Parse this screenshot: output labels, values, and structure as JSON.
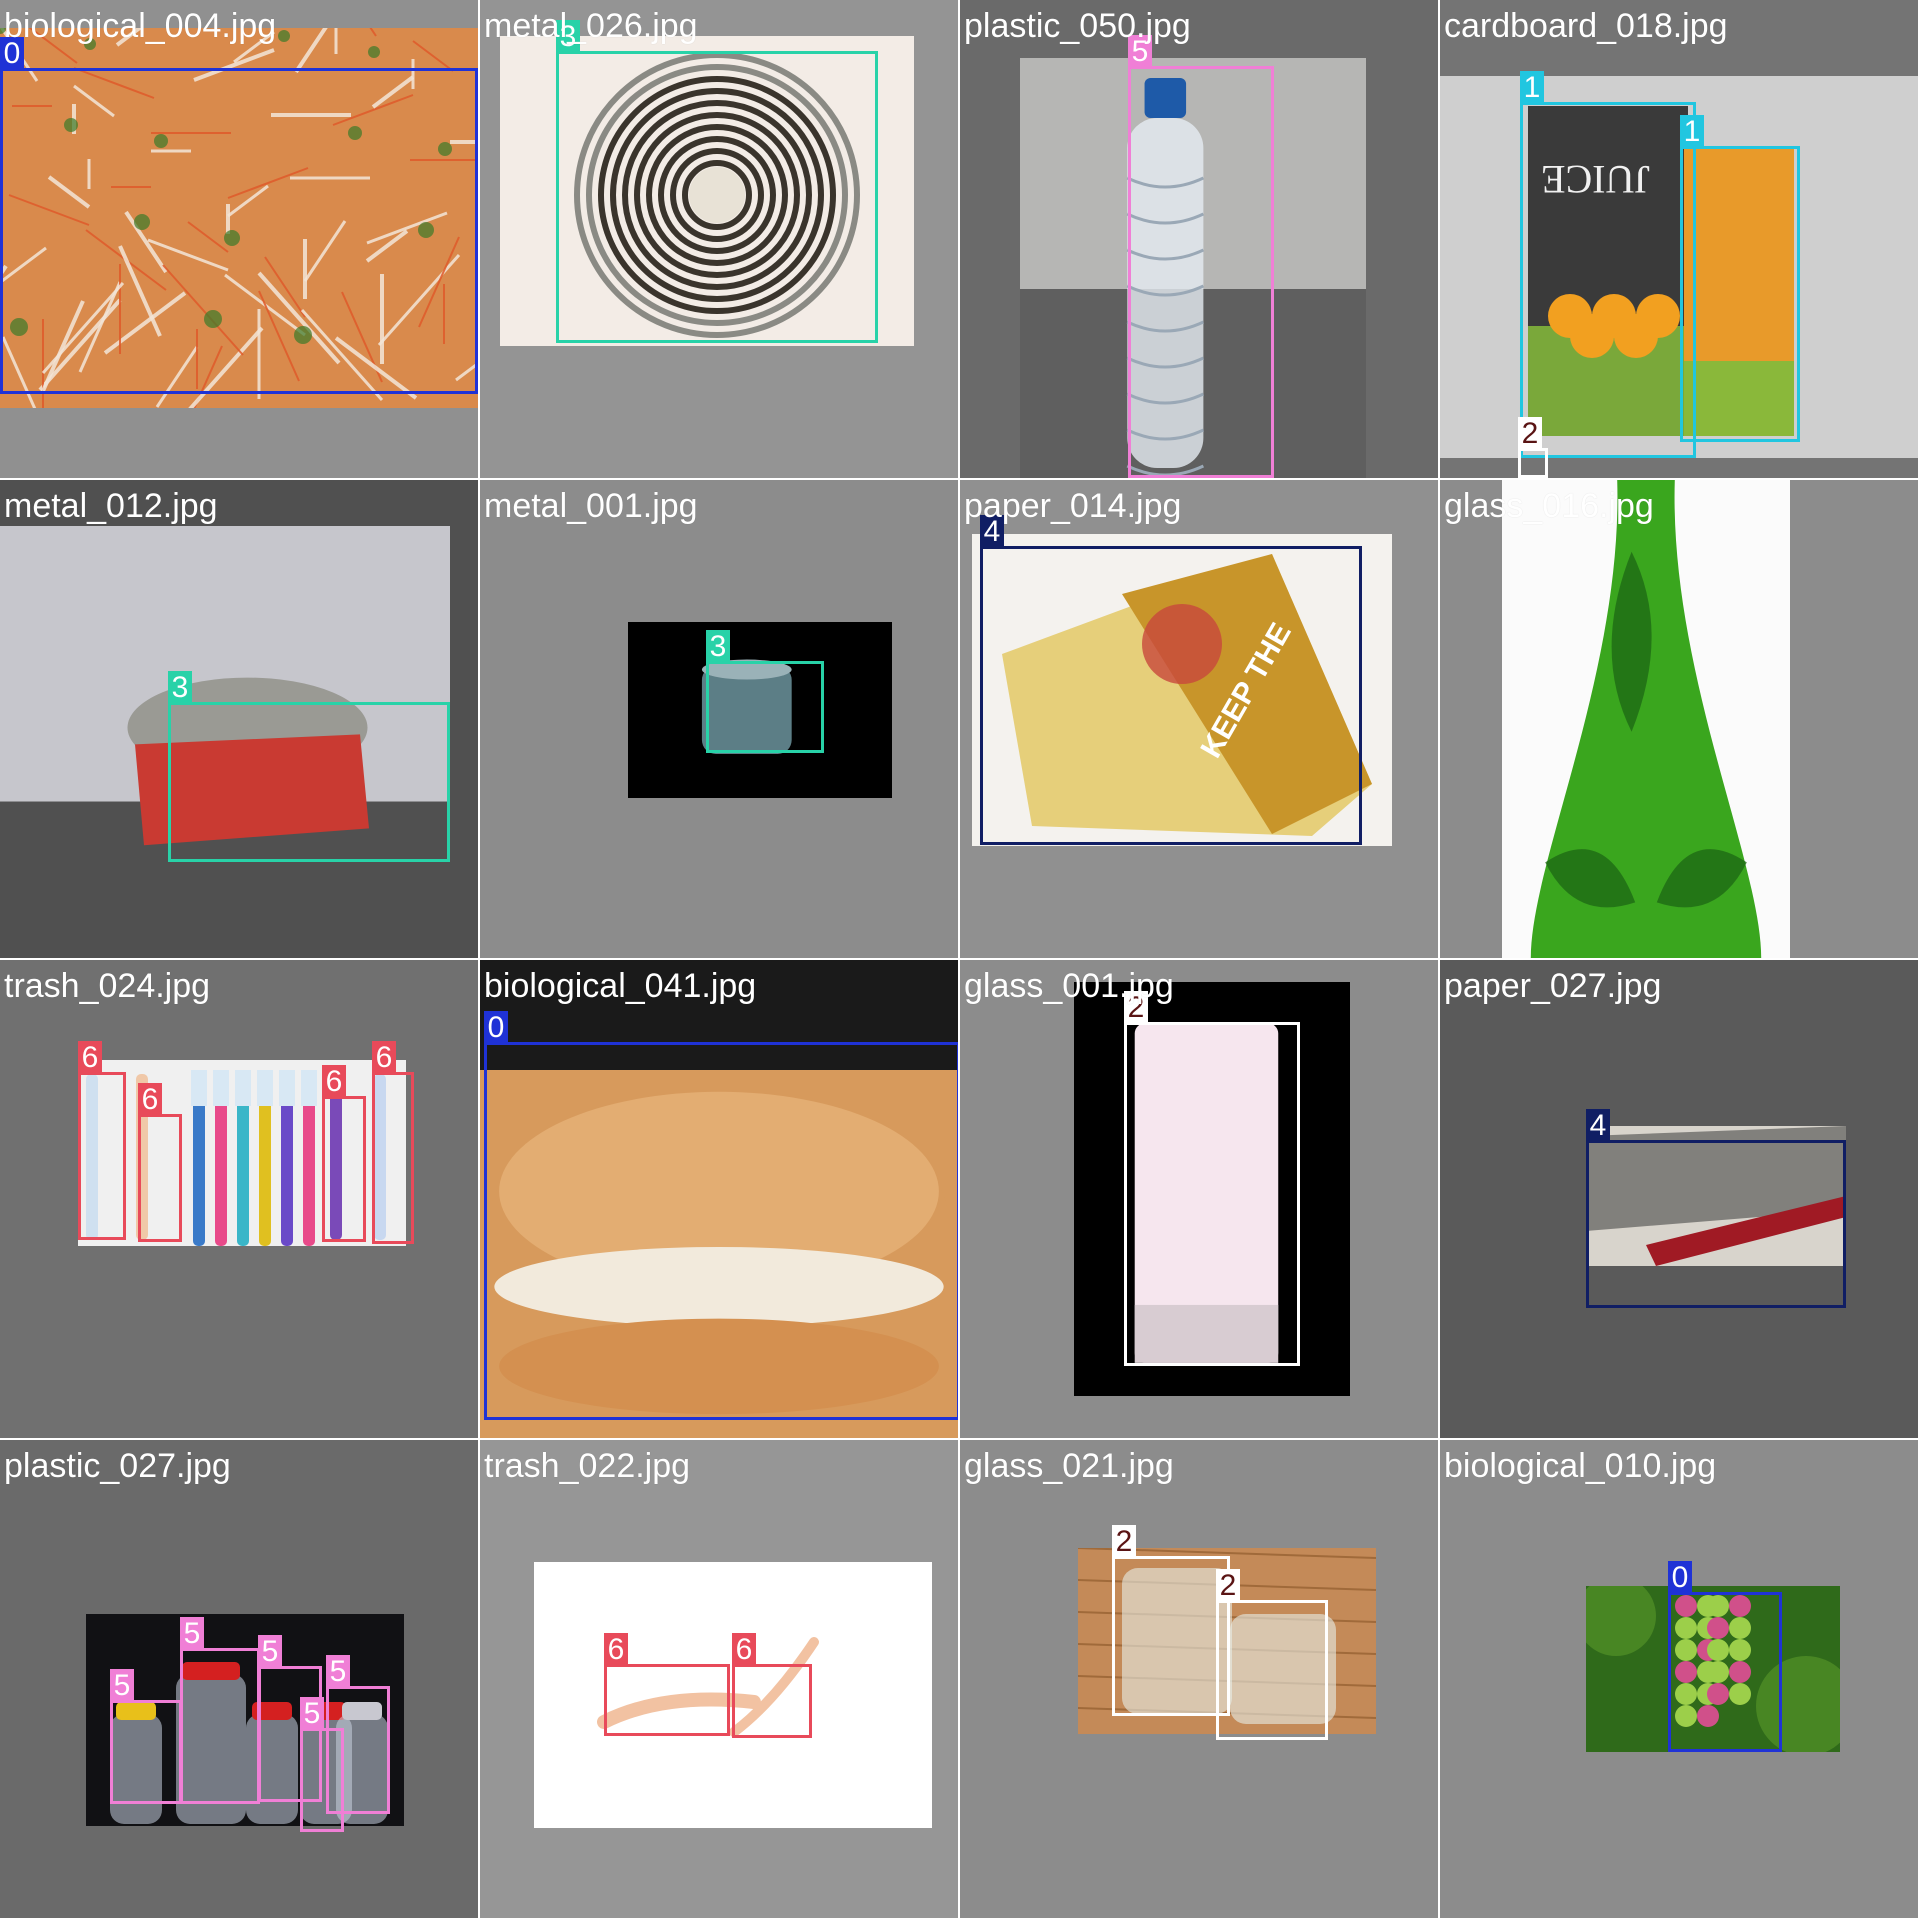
{
  "title": "",
  "class_colors": {
    "0": "#1f32d6",
    "1": "#21c6e0",
    "2": "#ffffff",
    "3": "#28d2a8",
    "4": "#101e64",
    "5": "#f07fd6",
    "6": "#e84a5a"
  },
  "class_label_colors": {
    "2": "#5a1414"
  },
  "tiles": [
    {
      "file": "biological_004.jpg",
      "bg": "#909090",
      "image": {
        "fill": "#d98a4c",
        "accent": "#f3e6d8",
        "texture": "shreds"
      },
      "boxes": [
        {
          "class": "0",
          "label": "0"
        }
      ]
    },
    {
      "file": "metal_026.jpg",
      "bg": "#949494",
      "image": {
        "fill": "#f3ece6",
        "accent": "#2a2620",
        "texture": "can-top"
      },
      "boxes": [
        {
          "class": "3",
          "label": "3"
        }
      ]
    },
    {
      "file": "plastic_050.jpg",
      "bg": "#6a6a6a",
      "image": {
        "fill": "#b6b6b4",
        "accent": "#e6ecf2",
        "texture": "bottle"
      },
      "boxes": [
        {
          "class": "5",
          "label": "5"
        }
      ]
    },
    {
      "file": "cardboard_018.jpg",
      "bg": "#747474",
      "image": {
        "fill": "#cfcfcf",
        "accent": "#3a3a3a",
        "texture": "juice"
      },
      "boxes": [
        {
          "class": "1",
          "label": "1"
        },
        {
          "class": "1",
          "label": "1"
        },
        {
          "class": "2",
          "label": "2"
        }
      ]
    },
    {
      "file": "metal_012.jpg",
      "bg": "#505050",
      "image": {
        "fill": "#c6c6cc",
        "accent": "#c93a32",
        "texture": "red-can"
      },
      "boxes": [
        {
          "class": "3",
          "label": "3"
        }
      ]
    },
    {
      "file": "metal_001.jpg",
      "bg": "#8c8c8c",
      "image": {
        "fill": "#000000",
        "accent": "#5c7e86",
        "texture": "tuna"
      },
      "boxes": [
        {
          "class": "3",
          "label": "3"
        }
      ]
    },
    {
      "file": "paper_014.jpg",
      "bg": "#909090",
      "image": {
        "fill": "#f4f2ee",
        "accent": "#c8952a",
        "texture": "magazine"
      },
      "boxes": [
        {
          "class": "4",
          "label": "4"
        }
      ]
    },
    {
      "file": "glass_016.jpg",
      "bg": "#8c8c8c",
      "image": {
        "fill": "#fbfbfb",
        "accent": "#3aa61e",
        "texture": "vase"
      },
      "boxes": []
    },
    {
      "file": "trash_024.jpg",
      "bg": "#707070",
      "image": {
        "fill": "#f0f0f0",
        "accent": "#3a7ac8",
        "texture": "toothbrush"
      },
      "boxes": [
        {
          "class": "6",
          "label": "6"
        },
        {
          "class": "6",
          "label": "6"
        },
        {
          "class": "6",
          "label": "6"
        },
        {
          "class": "6",
          "label": "6"
        }
      ]
    },
    {
      "file": "biological_041.jpg",
      "bg": "#1a1a1a",
      "image": {
        "fill": "#d79a5c",
        "accent": "#f2eadc",
        "texture": "bun"
      },
      "boxes": [
        {
          "class": "0",
          "label": "0"
        }
      ]
    },
    {
      "file": "glass_001.jpg",
      "bg": "#8c8c8c",
      "image": {
        "fill": "#000000",
        "accent": "#f6e6ee",
        "texture": "glass"
      },
      "boxes": [
        {
          "class": "2",
          "label": "2"
        }
      ]
    },
    {
      "file": "paper_027.jpg",
      "bg": "#5a5a5a",
      "image": {
        "fill": "#d8d4cc",
        "accent": "#a01a24",
        "texture": "book"
      },
      "boxes": [
        {
          "class": "4",
          "label": "4"
        }
      ]
    },
    {
      "file": "plastic_027.jpg",
      "bg": "#6a6a6a",
      "image": {
        "fill": "#111114",
        "accent": "#d42020",
        "texture": "jars"
      },
      "boxes": [
        {
          "class": "5",
          "label": "5"
        },
        {
          "class": "5",
          "label": "5"
        },
        {
          "class": "5",
          "label": "5"
        },
        {
          "class": "5",
          "label": "5"
        },
        {
          "class": "5",
          "label": "5"
        }
      ]
    },
    {
      "file": "trash_022.jpg",
      "bg": "#969696",
      "image": {
        "fill": "#ffffff",
        "accent": "#f2c2a2",
        "texture": "smear"
      },
      "boxes": [
        {
          "class": "6",
          "label": "6"
        },
        {
          "class": "6",
          "label": "6"
        }
      ]
    },
    {
      "file": "glass_021.jpg",
      "bg": "#8c8c8c",
      "image": {
        "fill": "#c48a58",
        "accent": "#e8efe8",
        "texture": "jar-glass"
      },
      "boxes": [
        {
          "class": "2",
          "label": "2"
        },
        {
          "class": "2",
          "label": "2"
        }
      ]
    },
    {
      "file": "biological_010.jpg",
      "bg": "#8c8c8c",
      "image": {
        "fill": "#2f6a1a",
        "accent": "#9ccf4a",
        "texture": "grapes"
      },
      "boxes": [
        {
          "class": "0",
          "label": "0"
        }
      ]
    }
  ]
}
